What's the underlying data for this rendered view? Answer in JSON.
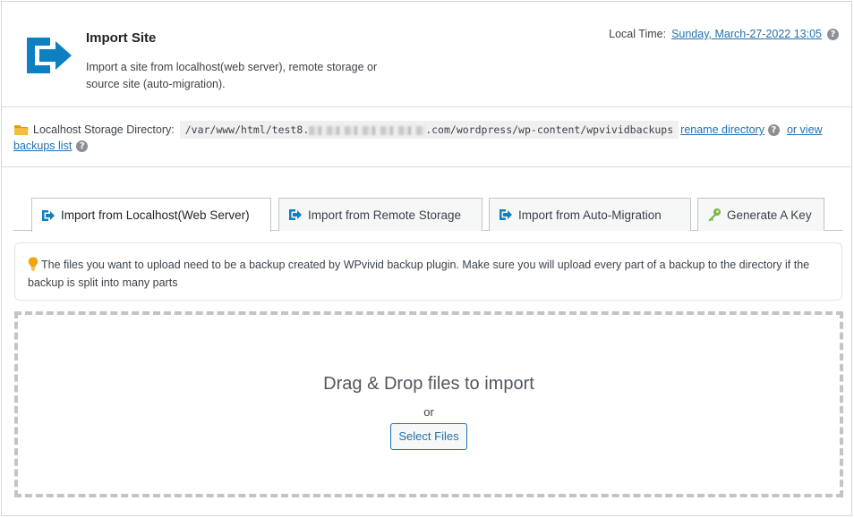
{
  "header": {
    "title": "Import Site",
    "description": "Import a site from localhost(web server), remote storage or source site (auto-migration).",
    "local_time_label": "Local Time:",
    "local_time_value": "Sunday, March-27-2022 13:05"
  },
  "storage": {
    "label": "Localhost Storage Directory:",
    "path_prefix": "/var/www/html/test8.",
    "path_suffix": ".com/wordpress/wp-content/wpvividbackups",
    "rename_link": "rename directory",
    "view_link_part1": "or view",
    "view_link_part2": "backups list"
  },
  "tabs": [
    {
      "label": "Import from Localhost(Web Server)",
      "icon": "import-arrow-icon",
      "active": true
    },
    {
      "label": "Import from Remote Storage",
      "icon": "import-arrow-icon",
      "active": false
    },
    {
      "label": "Import from Auto-Migration",
      "icon": "import-arrow-icon",
      "active": false
    },
    {
      "label": "Generate A Key",
      "icon": "key-icon",
      "active": false
    }
  ],
  "notice": {
    "text": "The files you want to upload need to be a backup created by WPvivid backup plugin. Make sure you will upload every part of a backup to the directory if the backup is split into many parts"
  },
  "dropzone": {
    "title": "Drag & Drop files to import",
    "or": "or",
    "button": "Select Files"
  },
  "help_glyph": "?",
  "colors": {
    "brand_blue": "#0e7fc1",
    "link_blue": "#2271b1",
    "key_green": "#7ab648",
    "bulb_orange": "#f0a30a",
    "folder_yellow": "#f2b134"
  }
}
